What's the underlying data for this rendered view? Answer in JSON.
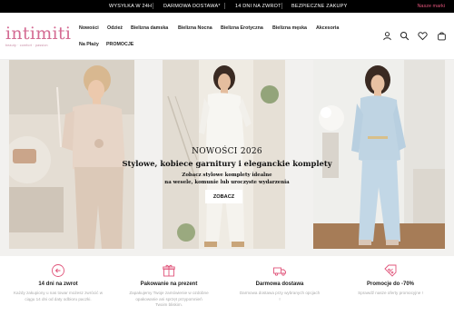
{
  "topbar": {
    "messages": [
      "WYSYŁKA W 24H",
      "DARMOWA DOSTAWA*",
      "14 DNI NA ZWROT",
      "BEZPIECZNE ZAKUPY"
    ],
    "brand_link": "Nasze marki"
  },
  "logo": {
    "word": "intimiti",
    "tagline": "beauty · comfort · passion"
  },
  "nav": {
    "items": [
      "Nowości",
      "Odzież",
      "Bielizna damska",
      "Bielizna Nocna",
      "Bielizna Erotyczna",
      "Bielizna męska",
      "Akcesoria",
      "Na Płaży",
      "PROMOCJE"
    ]
  },
  "header_icons": [
    "user-icon",
    "search-icon",
    "heart-icon",
    "cart-icon"
  ],
  "hero": {
    "title": "NOWOŚCI 2026",
    "subtitle": "Stylowe, kobiece garnitury i eleganckie komplety",
    "description_line1": "Zobacz stylowe komplety idealne",
    "description_line2": "na wesele, komunie lub uroczyste wydarzenia",
    "button": "ZOBACZ"
  },
  "features": [
    {
      "icon": "return-icon",
      "title": "14 dni na zwrot",
      "desc_line1": "Każdy zakupiony u nas towar możesz zwrócić w",
      "desc_line2": "ciągu 14 dni od daty odbioru paczki."
    },
    {
      "icon": "gift-icon",
      "title": "Pakowanie na prezent",
      "desc_line1": "Zapakujemy Twoje zamówienie w ozdobne",
      "desc_line2": "opakowanie ani sprzęt przypomnień",
      "desc_line3": "Twoim bliskim."
    },
    {
      "icon": "truck-icon",
      "title": "Darmowa dostawa",
      "desc_line1": "Darmowa dostawa przy wybranych opcjach",
      "desc_line2": "!"
    },
    {
      "icon": "percent-tag-icon",
      "title": "Promocje do -70%",
      "desc_line1": "Sprawdź nasze oferty promocyjne !"
    }
  ],
  "colors": {
    "brand_pink": "#d46b93",
    "topbar_bg": "#000000",
    "accent_link": "#e0547a"
  }
}
